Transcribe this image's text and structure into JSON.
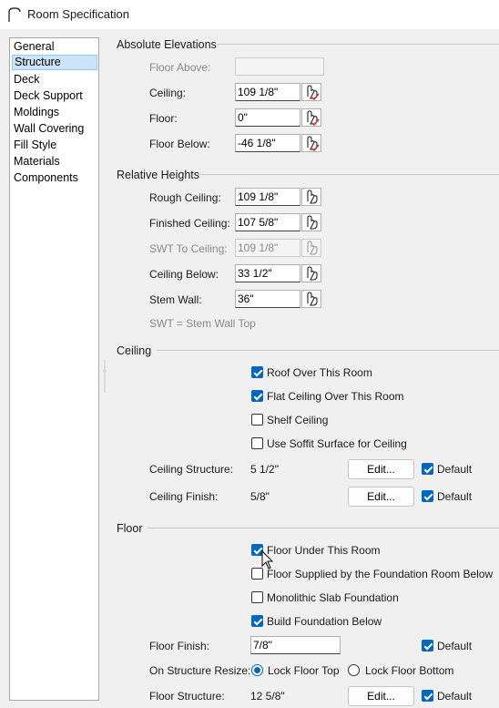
{
  "window": {
    "title": "Room Specification"
  },
  "sidebar": {
    "items": [
      {
        "label": "General"
      },
      {
        "label": "Structure"
      },
      {
        "label": "Deck"
      },
      {
        "label": "Deck Support"
      },
      {
        "label": "Moldings"
      },
      {
        "label": "Wall Covering"
      },
      {
        "label": "Fill Style"
      },
      {
        "label": "Materials"
      },
      {
        "label": "Components"
      }
    ],
    "selected": "Structure"
  },
  "absolute_elevations": {
    "title": "Absolute Elevations",
    "floor_above": {
      "label": "Floor Above:",
      "value": ""
    },
    "ceiling": {
      "label": "Ceiling:",
      "value": "109 1/8\""
    },
    "floor": {
      "label": "Floor:",
      "value": "0\""
    },
    "floor_below": {
      "label": "Floor Below:",
      "value": "-46 1/8\""
    }
  },
  "relative_heights": {
    "title": "Relative Heights",
    "rough_ceiling": {
      "label": "Rough Ceiling:",
      "value": "109 1/8\""
    },
    "finished_ceiling": {
      "label": "Finished Ceiling:",
      "value": "107 5/8\""
    },
    "swt_to_ceiling": {
      "label": "SWT To Ceiling:",
      "value": "109 1/8\""
    },
    "ceiling_below": {
      "label": "Ceiling Below:",
      "value": "33 1/2\""
    },
    "stem_wall": {
      "label": "Stem Wall:",
      "value": "36\""
    },
    "note": "SWT = Stem Wall Top"
  },
  "ceiling": {
    "title": "Ceiling",
    "roof_over": {
      "label": "Roof Over This Room",
      "checked": true
    },
    "flat_ceiling": {
      "label": "Flat Ceiling Over This Room",
      "checked": true
    },
    "shelf_ceiling": {
      "label": "Shelf Ceiling",
      "checked": false
    },
    "soffit_surface": {
      "label": "Use Soffit Surface for Ceiling",
      "checked": false
    },
    "structure": {
      "label": "Ceiling Structure:",
      "value": "5 1/2\"",
      "button": "Edit...",
      "default_label": "Default",
      "default_checked": true
    },
    "finish": {
      "label": "Ceiling Finish:",
      "value": "5/8\"",
      "button": "Edit...",
      "default_label": "Default",
      "default_checked": true
    }
  },
  "floor": {
    "title": "Floor",
    "floor_under": {
      "label": "Floor Under This Room",
      "checked": true
    },
    "floor_supplied": {
      "label": "Floor Supplied by the Foundation Room Below",
      "checked": false
    },
    "monolithic": {
      "label": "Monolithic Slab Foundation",
      "checked": false
    },
    "build_foundation": {
      "label": "Build Foundation Below",
      "checked": true
    },
    "finish": {
      "label": "Floor Finish:",
      "value": "7/8\"",
      "default_label": "Default",
      "default_checked": true
    },
    "resize": {
      "label": "On Structure Resize:",
      "lock_top": "Lock Floor Top",
      "lock_bottom": "Lock Floor Bottom",
      "selected": "lock_top"
    },
    "structure": {
      "label": "Floor Structure:",
      "value": "12 5/8\"",
      "button": "Edit...",
      "default_label": "Default",
      "default_checked": true
    }
  },
  "colors": {
    "accent": "#0067c0",
    "selection": "#cce4f7",
    "pointer_icon_red": "#d9261c"
  }
}
